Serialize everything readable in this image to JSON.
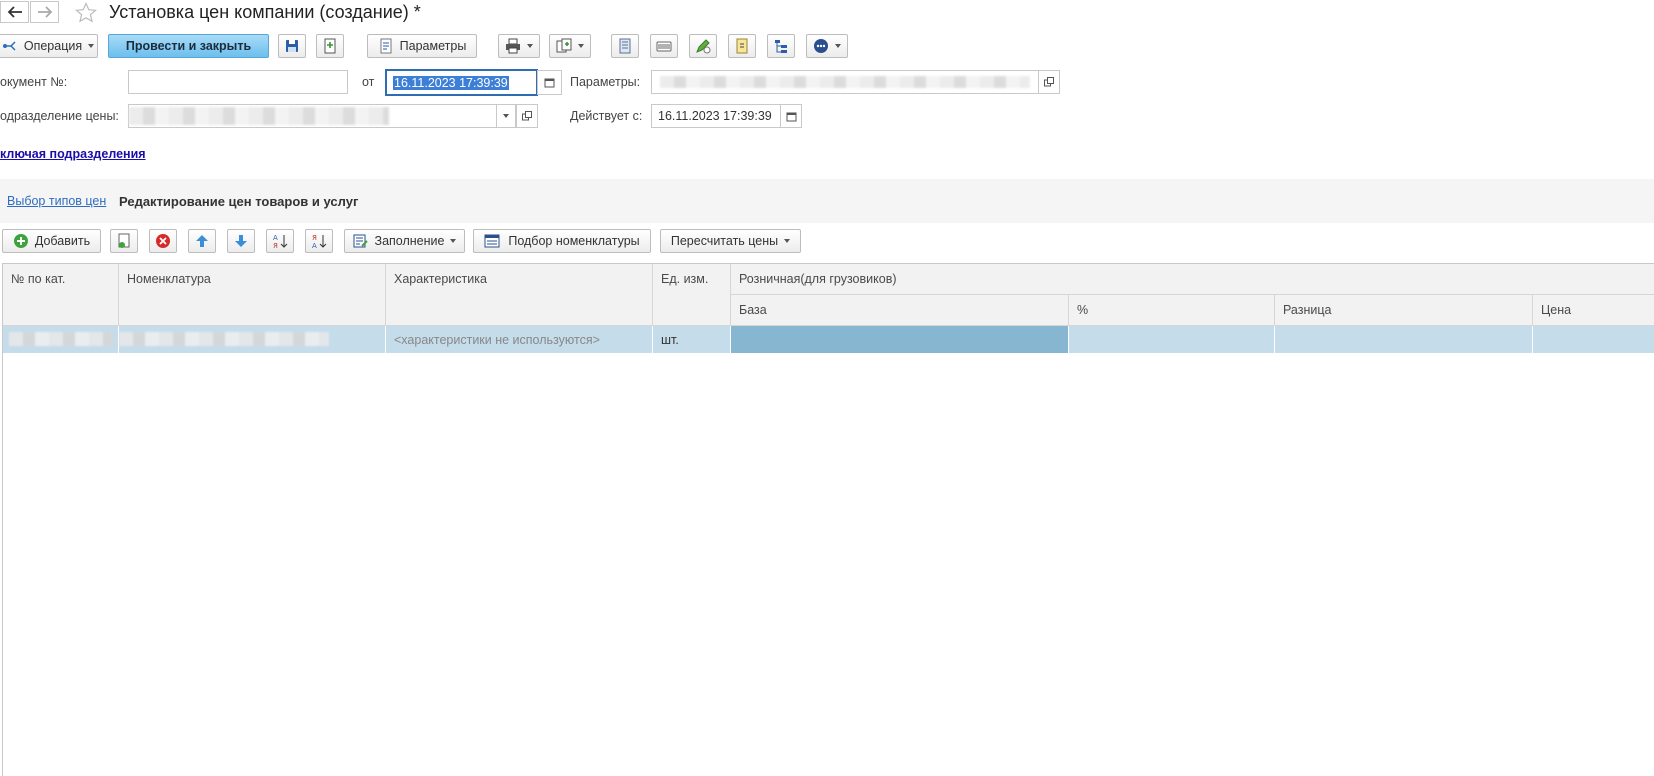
{
  "window": {
    "title": "Установка цен компании (создание) *"
  },
  "toolbar": {
    "operation_label": "Операция",
    "post_close_label": "Провести и закрыть",
    "params_label": "Параметры"
  },
  "form": {
    "doc_number_label": "окумент №:",
    "doc_number_value": "",
    "from_label": "от",
    "date_value": "16.11.2023 17:39:39",
    "params_label": "Параметры:",
    "division_label": "одразделение цены:",
    "valid_from_label": "Действует с:",
    "valid_from_value": "16.11.2023 17:39:39",
    "include_divisions_link": "ключая подразделения"
  },
  "tabs": {
    "select_types_link": "Выбор типов цен",
    "active_tab": "Редактирование цен товаров и услуг"
  },
  "table_toolbar": {
    "add_label": "Добавить",
    "fill_label": "Заполнение",
    "pick_label": "Подбор номенклатуры",
    "recalc_label": "Пересчитать цены"
  },
  "table": {
    "columns": {
      "num": "№ по кат.",
      "nomenclature": "Номенклатура",
      "characteristic": "Характеристика",
      "unit": "Ед. изм.",
      "group": "Розничная(для грузовиков)",
      "base": "База",
      "percent": "%",
      "diff": "Разница",
      "price": "Цена"
    },
    "rows": [
      {
        "num": "",
        "nomenclature": "",
        "characteristic": "<характеристики не используются>",
        "unit": "шт.",
        "base": "",
        "percent": "",
        "diff": "",
        "price": ""
      }
    ]
  },
  "colors": {
    "accent": "#6cbfee",
    "selected_row": "#c5dcea",
    "selected_cell": "#86b6d0",
    "link": "#1a0dab"
  }
}
